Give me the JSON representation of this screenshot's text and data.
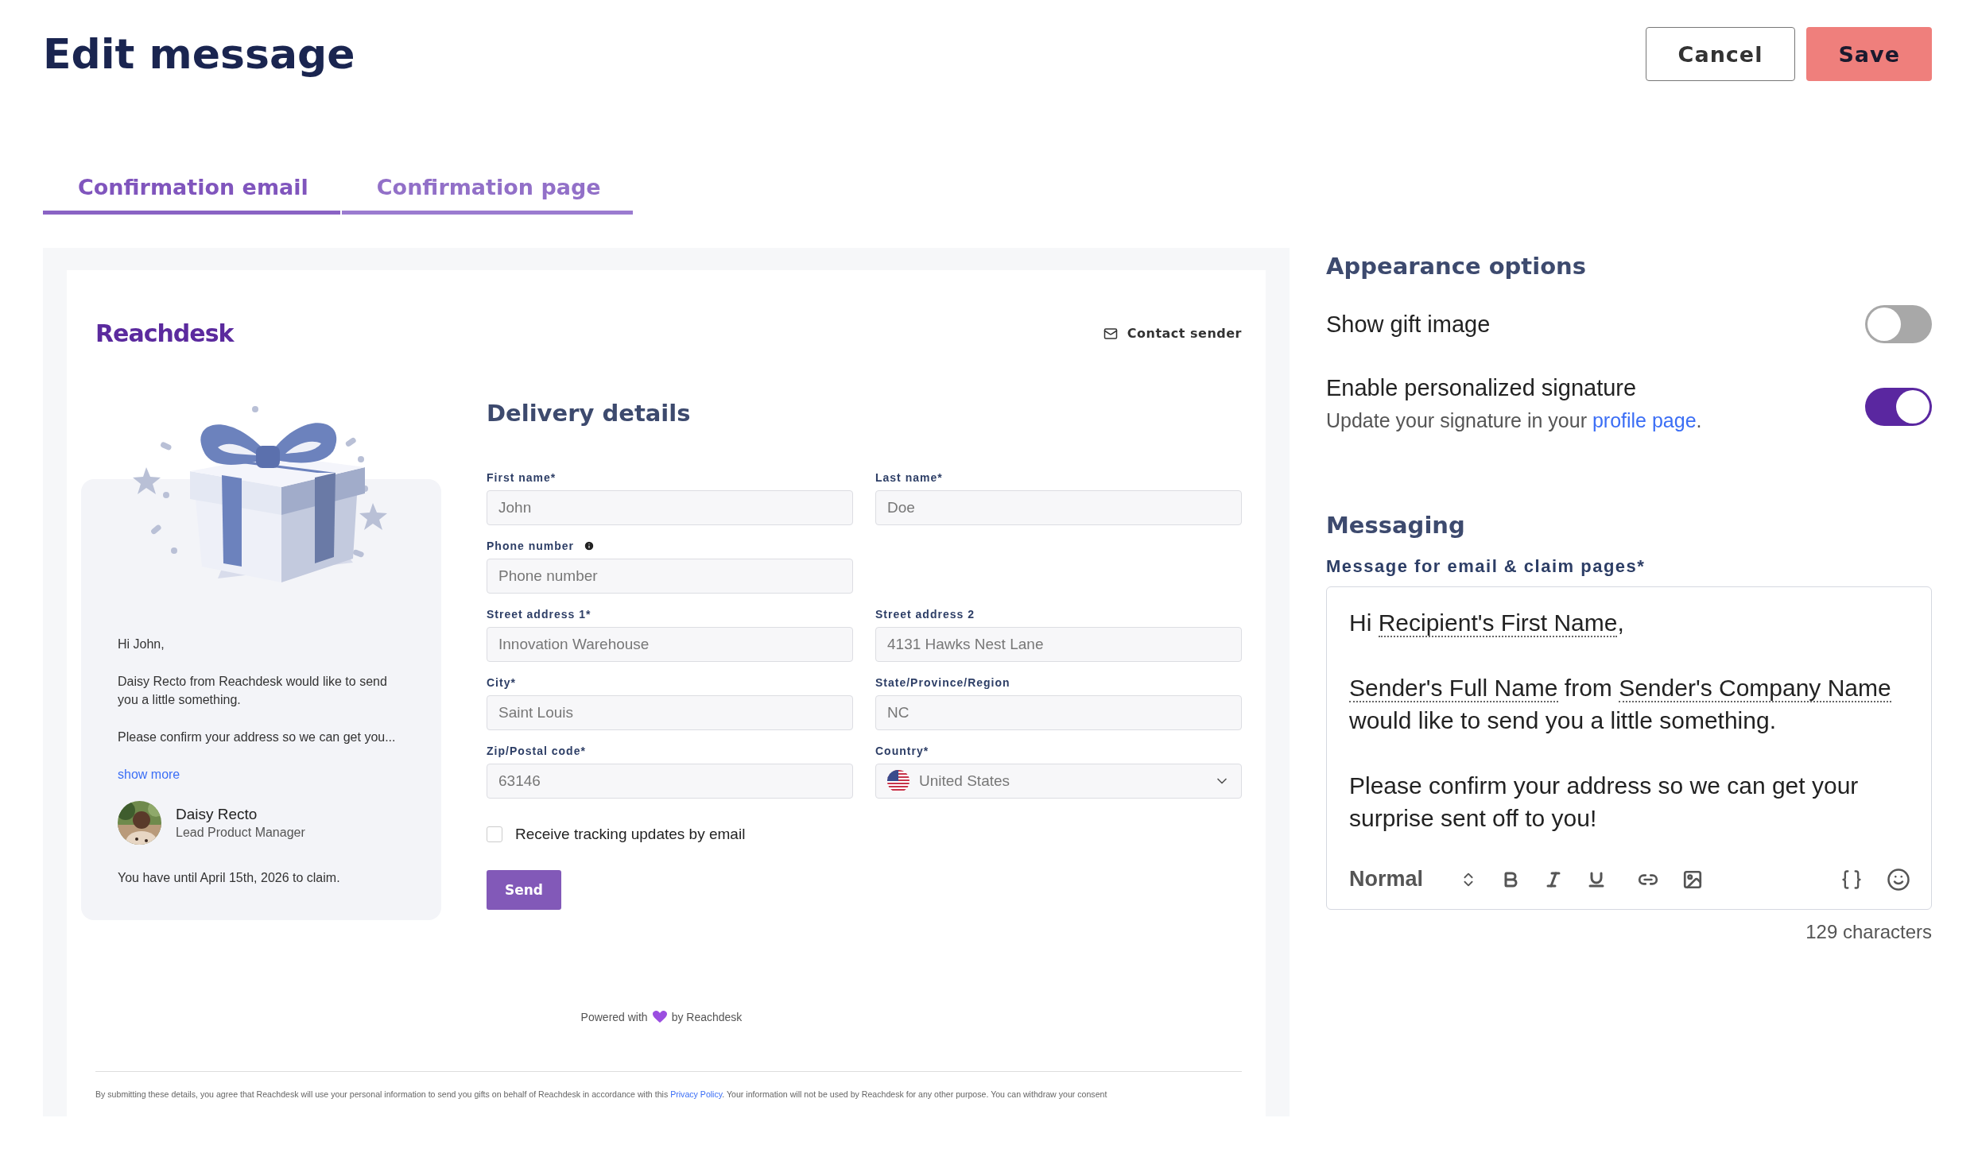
{
  "header": {
    "title": "Edit message",
    "buttons": [
      {
        "label": "Cancel",
        "kind": "secondary"
      },
      {
        "label": "Save",
        "kind": "primary"
      }
    ]
  },
  "tabs": [
    {
      "label": "Confirmation email",
      "selected": true
    },
    {
      "label": "Confirmation page",
      "selected": false
    }
  ],
  "preview": {
    "logo": "Reachdesk",
    "contact": "Contact sender",
    "card": {
      "greeting": "Hi John,",
      "paragraphs": [
        "Daisy Recto from Reachdesk would like to send you a little something.",
        "Please confirm your address so we can get you..."
      ],
      "show_more": "show more",
      "sender_name": "Daisy Recto",
      "sender_role": "Lead Product Manager",
      "deadline": "You have until April 15th, 2026 to claim."
    },
    "form": {
      "title": "Delivery details",
      "rows": [
        [
          {
            "label": "First name*",
            "value": "John",
            "kind": "text"
          },
          {
            "label": "Last name*",
            "value": "Doe",
            "kind": "text"
          }
        ],
        [
          {
            "label": "Phone number",
            "placeholder": "Phone number",
            "kind": "text",
            "info": true
          }
        ],
        [
          {
            "label": "Street address 1*",
            "value": "Innovation Warehouse",
            "kind": "text"
          },
          {
            "label": "Street address 2",
            "value": "4131 Hawks Nest Lane",
            "kind": "text"
          }
        ],
        [
          {
            "label": "City*",
            "value": "Saint Louis",
            "kind": "text"
          },
          {
            "label": "State/Province/Region",
            "value": "NC",
            "kind": "text"
          }
        ],
        [
          {
            "label": "Zip/Postal code*",
            "value": "63146",
            "kind": "text"
          },
          {
            "label": "Country*",
            "value": "United States",
            "kind": "select"
          }
        ]
      ],
      "checkbox": {
        "label": "Receive tracking updates by email",
        "checked": false
      },
      "submit": "Send"
    },
    "powered": "Powered with",
    "powered_by": "by Reachdesk",
    "legal": "By submitting these details, you agree that Reachdesk will use your personal information to send you gifts on behalf of Reachdesk in accordance with this ",
    "legal_link": "Privacy Policy",
    "legal_end": ". Your information will not be used by Reachdesk for any other purpose. You can withdraw your consent"
  },
  "appearance": {
    "title": "Appearance options",
    "toggles": [
      {
        "label": "Show gift image",
        "on": false
      },
      {
        "label": "Enable personalized signature",
        "on": true,
        "hint": "Update your signature in your ",
        "hint_link": "profile page",
        "hint_end": "."
      }
    ]
  },
  "messaging": {
    "title": "Messaging",
    "label": "Message for email & claim pages*",
    "paragraphs": [
      [
        {
          "text": "Hi ",
          "kind": "text"
        },
        {
          "text": "Recipient's First Name",
          "kind": "variable"
        },
        {
          "text": ",",
          "kind": "text"
        }
      ],
      [
        {
          "text": "Sender's Full Name",
          "kind": "variable"
        },
        {
          "text": " from ",
          "kind": "text"
        },
        {
          "text": "Sender's Company Name",
          "kind": "variable"
        },
        {
          "text": " would like to send you a little something.",
          "kind": "text"
        }
      ],
      [
        {
          "text": "Please confirm your address so we can get your surprise sent off to you!",
          "kind": "text"
        }
      ]
    ],
    "format": "Normal",
    "count": "129 characters"
  }
}
